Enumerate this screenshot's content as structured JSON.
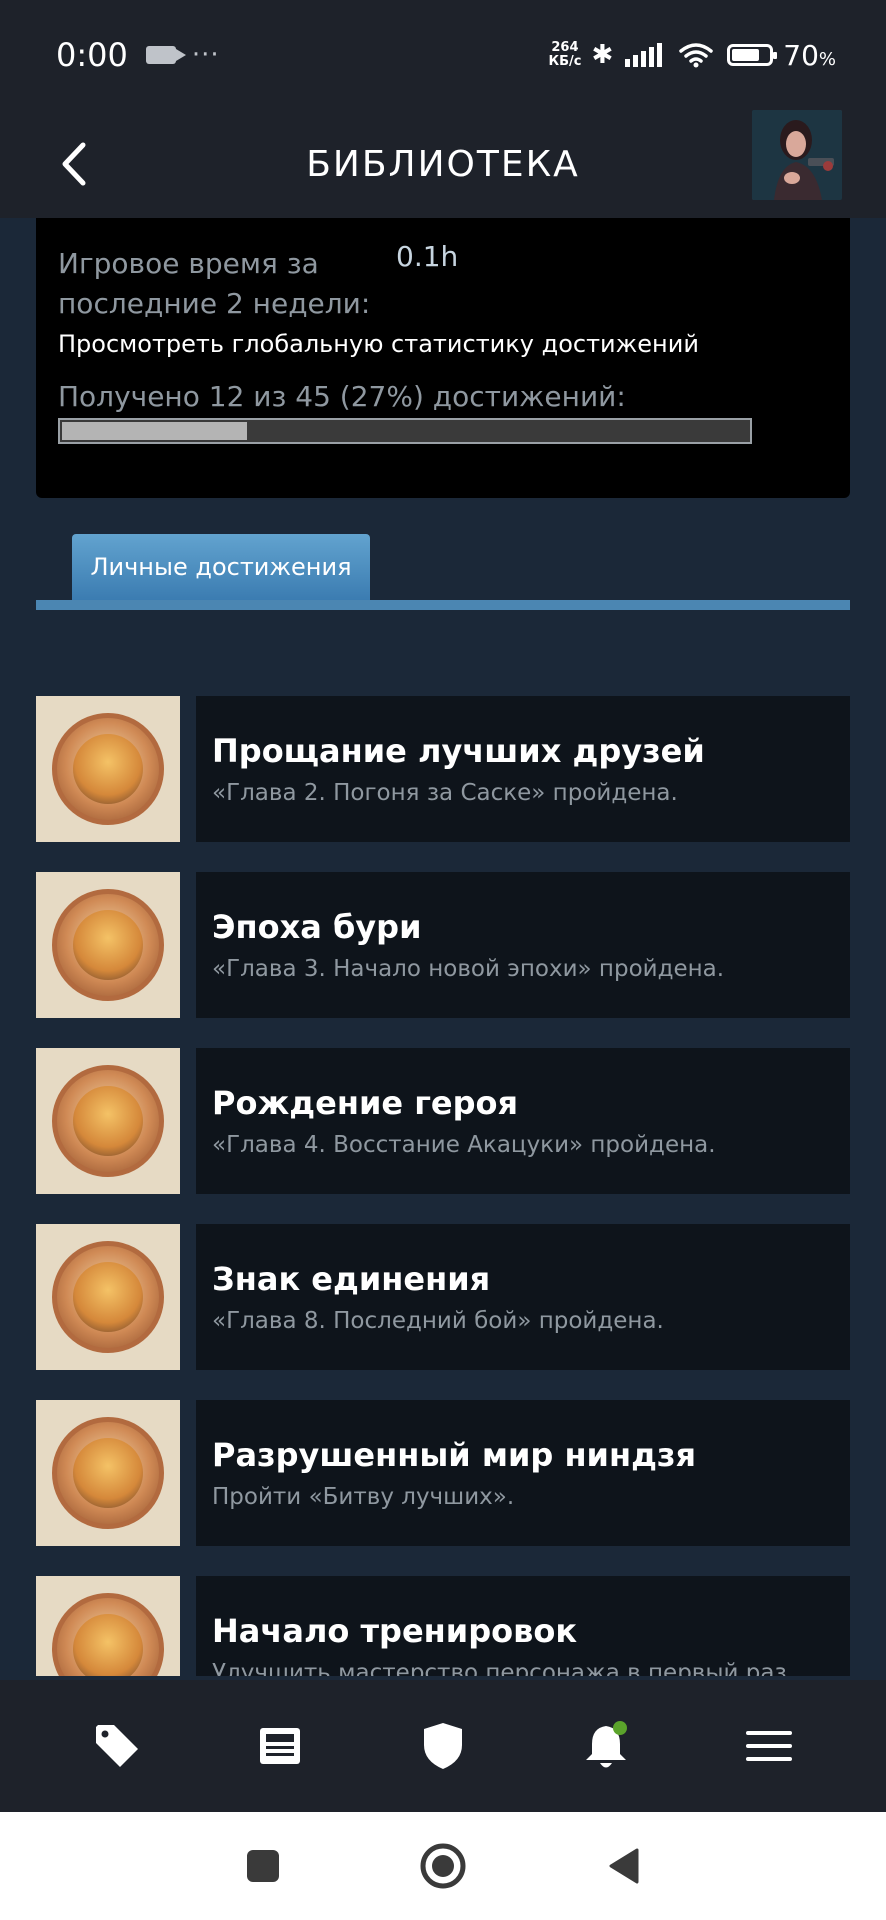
{
  "status_bar": {
    "time": "0:00",
    "dots": "···",
    "net_speed_top": "264",
    "net_speed_bottom": "КБ/с",
    "bluetooth": "✱",
    "battery_pct": "70",
    "battery_unit": "%"
  },
  "header": {
    "title": "БИБЛИОТЕКА",
    "back_icon": "chevron-left-icon",
    "avatar_icon": "user-avatar"
  },
  "stats": {
    "playtime_label": "Игровое время за последние 2 недели:",
    "playtime_value": "0.1h",
    "global_stats_link": "Просмотреть глобальную статистику достижений",
    "progress_label": "Получено 12 из 45 (27%) достижений:",
    "progress_fraction": 0.27
  },
  "tabs": {
    "personal": "Личные достижения"
  },
  "achievements": [
    {
      "title": "Прощание лучших друзей",
      "desc": "«Глава 2. Погоня за Саске» пройдена."
    },
    {
      "title": "Эпоха бури",
      "desc": "«Глава 3. Начало новой эпохи» пройдена."
    },
    {
      "title": "Рождение героя",
      "desc": "«Глава 4. Восстание Акацуки» пройдена."
    },
    {
      "title": "Знак единения",
      "desc": "«Глава 8. Последний бой» пройдена."
    },
    {
      "title": "Разрушенный мир ниндзя",
      "desc": "Пройти «Битву лучших»."
    },
    {
      "title": "Начало тренировок",
      "desc": "Улучшить мастерство персонажа в первый раз."
    }
  ],
  "bottom_nav": {
    "items": [
      "tag-icon",
      "news-icon",
      "shield-icon",
      "bell-icon",
      "menu-icon"
    ],
    "bell_badge_color": "#5ba32b"
  },
  "system_nav": {
    "items": [
      "recents-square-icon",
      "home-circle-icon",
      "back-triangle-icon"
    ]
  },
  "colors": {
    "background": "#1b2838",
    "header": "#1e222a",
    "panel": "#000000",
    "card": "#0e141b",
    "accent_tab": "#4b86b2",
    "muted_text": "#8f98a0"
  }
}
